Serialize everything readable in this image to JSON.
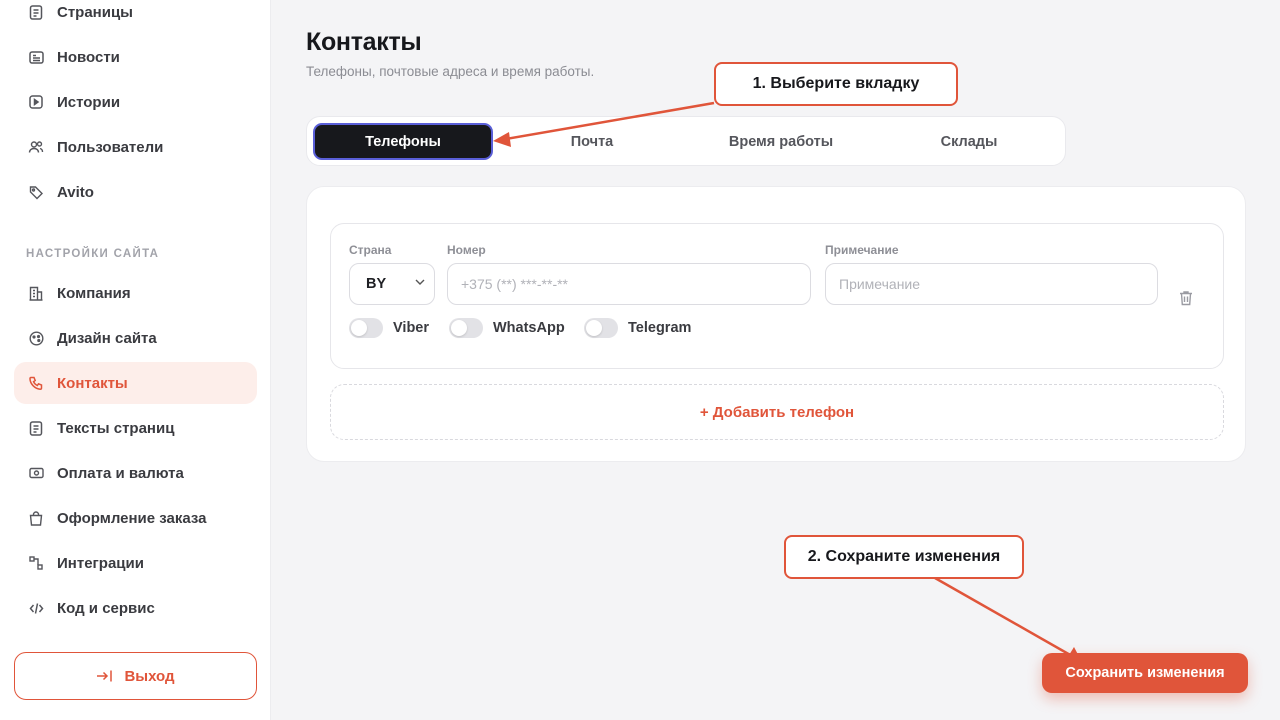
{
  "sidebar": {
    "items_top": [
      {
        "label": "Страницы",
        "icon": "document-icon"
      },
      {
        "label": "Новости",
        "icon": "newspaper-icon"
      },
      {
        "label": "Истории",
        "icon": "play-square-icon"
      },
      {
        "label": "Пользователи",
        "icon": "users-icon"
      },
      {
        "label": "Avito",
        "icon": "tag-icon"
      }
    ],
    "section_label": "НАСТРОЙКИ САЙТА",
    "items_settings": [
      {
        "label": "Компания",
        "icon": "building-icon"
      },
      {
        "label": "Дизайн сайта",
        "icon": "palette-icon"
      },
      {
        "label": "Контакты",
        "icon": "phone-icon",
        "active": true
      },
      {
        "label": "Тексты страниц",
        "icon": "text-document-icon"
      },
      {
        "label": "Оплата и валюта",
        "icon": "banknote-icon"
      },
      {
        "label": "Оформление заказа",
        "icon": "shopping-bag-icon"
      },
      {
        "label": "Интеграции",
        "icon": "integration-icon"
      },
      {
        "label": "Код и сервис",
        "icon": "code-icon"
      }
    ],
    "logout_label": "Выход"
  },
  "main": {
    "title": "Контакты",
    "subtitle": "Телефоны, почтовые адреса и время работы.",
    "tabs": [
      {
        "label": "Телефоны",
        "active": true
      },
      {
        "label": "Почта"
      },
      {
        "label": "Время работы"
      },
      {
        "label": "Склады"
      }
    ],
    "phone": {
      "country_label": "Страна",
      "country_value": "BY",
      "number_label": "Номер",
      "number_placeholder": "+375 (**) ***-**-**",
      "note_label": "Примечание",
      "note_placeholder": "Примечание",
      "messengers": [
        {
          "label": "Viber",
          "enabled": false
        },
        {
          "label": "WhatsApp",
          "enabled": false
        },
        {
          "label": "Telegram",
          "enabled": false
        }
      ]
    },
    "add_phone_label": "+ Добавить телефон",
    "save_label": "Сохранить изменения"
  },
  "annotations": {
    "step1": "1. Выберите вкладку",
    "step2": "2. Сохраните изменения"
  },
  "colors": {
    "accent": "#e0553a",
    "active_tab_bg": "#17181c",
    "active_tab_border": "#5a5fd8",
    "active_nav_bg": "#fdeeea",
    "page_bg": "#f4f4f6"
  }
}
